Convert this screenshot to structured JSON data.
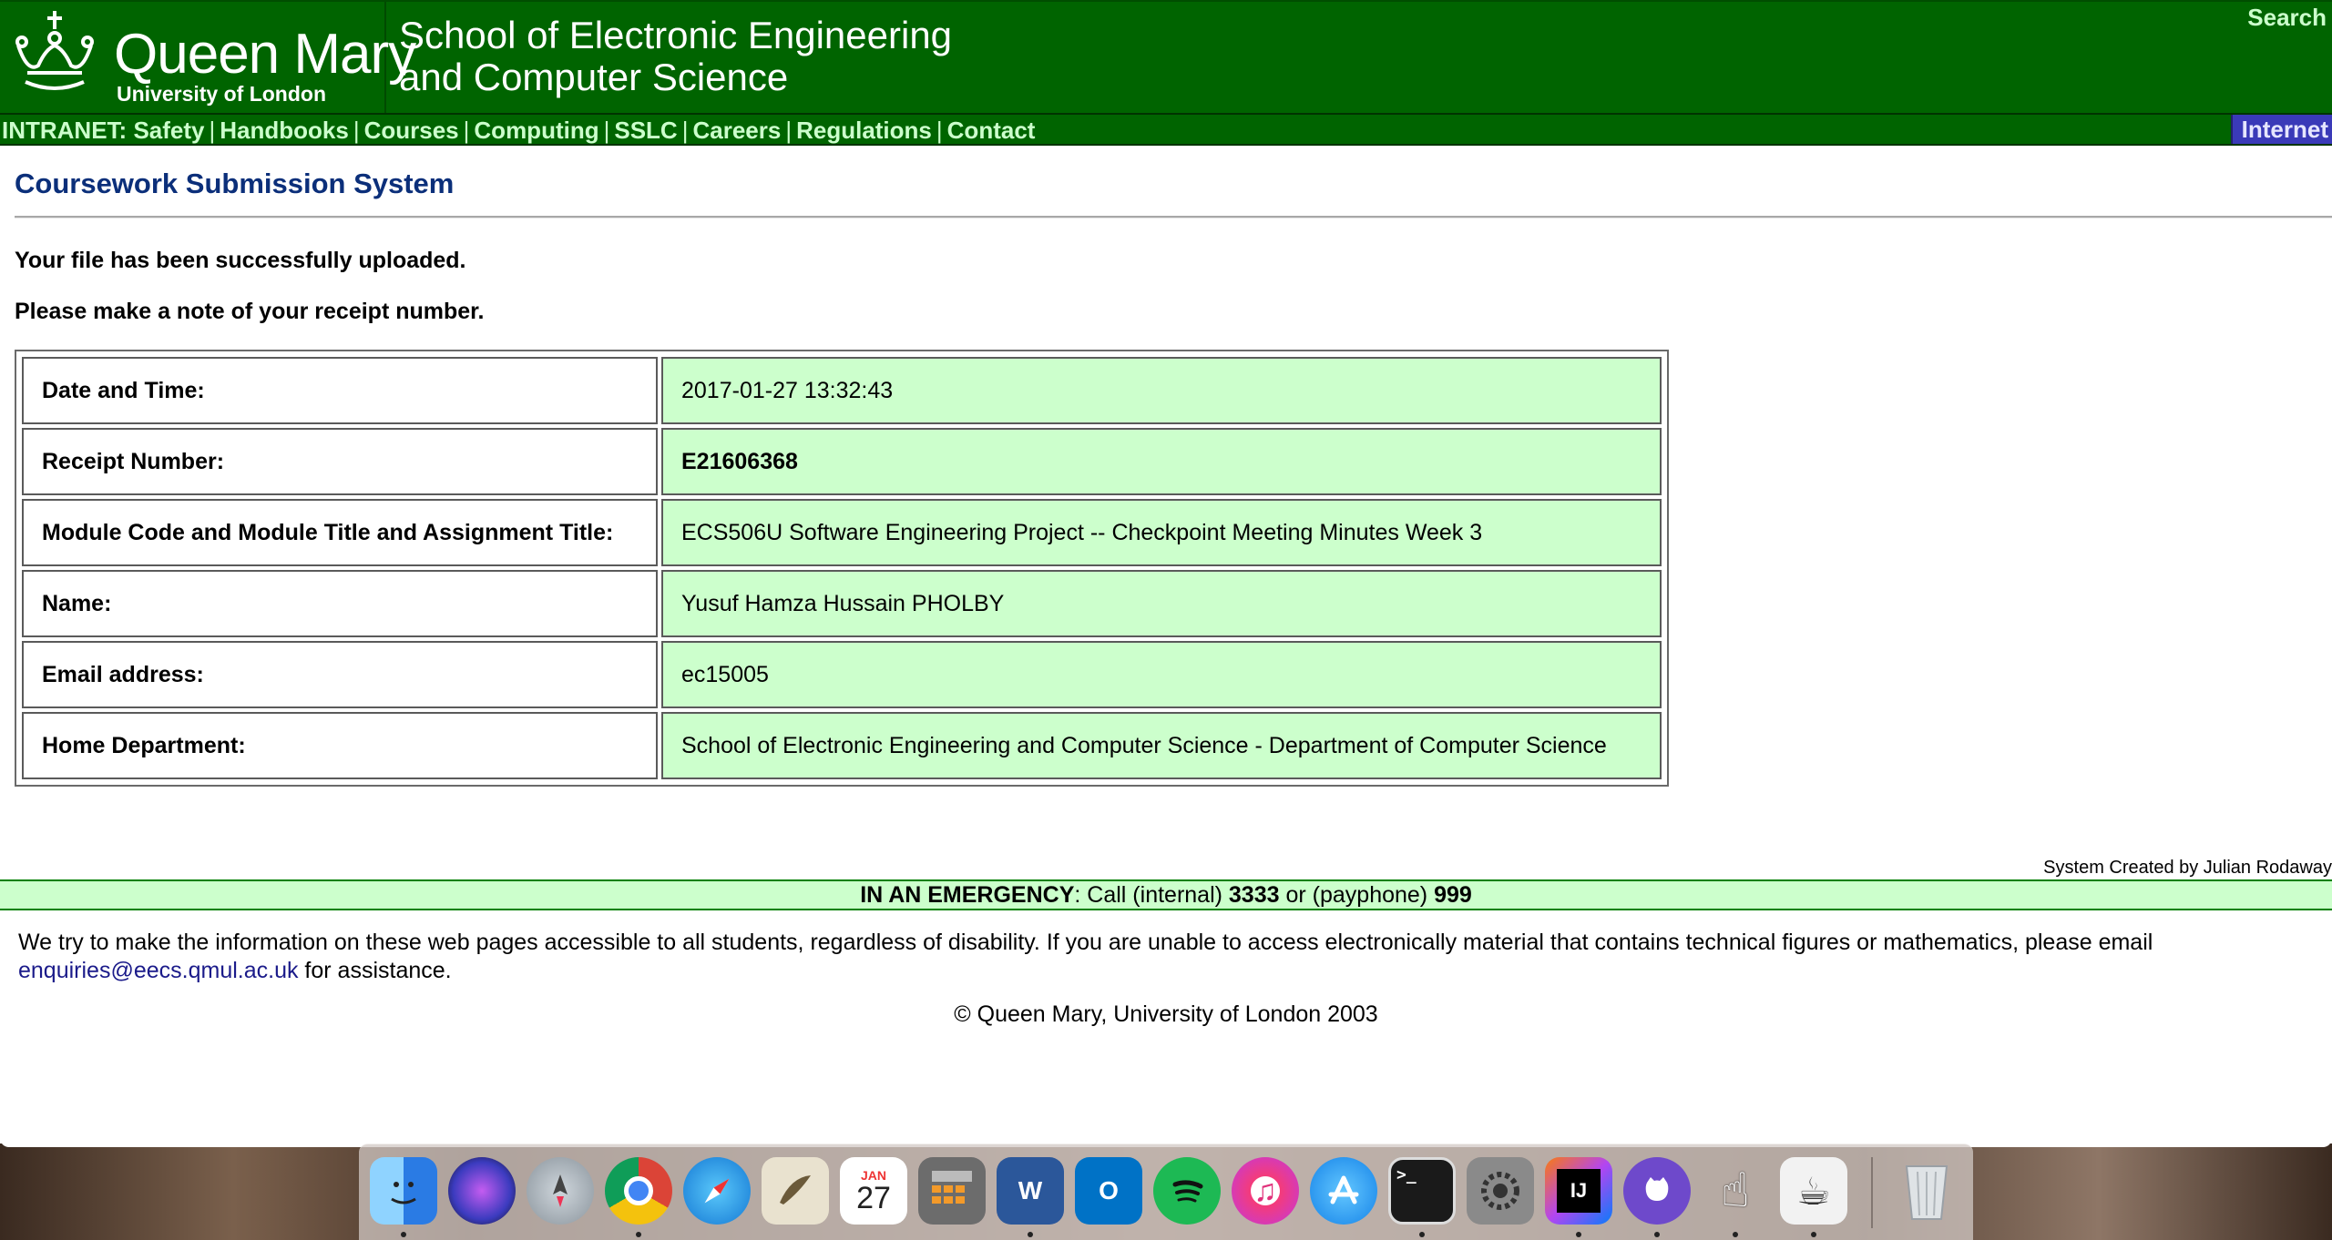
{
  "header": {
    "logo_name": "Queen Mary",
    "logo_sub": "University of London",
    "school_line1": "School of Electronic Engineering",
    "school_line2": "and Computer Science",
    "search": "Search"
  },
  "nav": {
    "prefix": "INTRANET: ",
    "items": [
      "Safety",
      "Handbooks",
      "Courses",
      "Computing",
      "SSLC",
      "Careers",
      "Regulations",
      "Contact"
    ],
    "internet": "Internet"
  },
  "main": {
    "title": "Coursework Submission System",
    "msg_uploaded": "Your file has been successfully uploaded.",
    "msg_note": "Please make a note of your receipt number.",
    "rows": [
      {
        "label": "Date and Time:",
        "value": "2017-01-27 13:32:43"
      },
      {
        "label": "Receipt Number:",
        "value": "E21606368"
      },
      {
        "label": "Module Code and Module Title and Assignment Title:",
        "value": "ECS506U Software Engineering Project -- Checkpoint Meeting Minutes Week 3"
      },
      {
        "label": "Name:",
        "value": "Yusuf Hamza Hussain PHOLBY"
      },
      {
        "label": "Email address:",
        "value": "ec15005"
      },
      {
        "label": "Home Department:",
        "value": "School of Electronic Engineering and Computer Science - Department of Computer Science"
      }
    ]
  },
  "footer": {
    "credits": "System Created by Julian Rodaway",
    "emergency_label": "IN AN EMERGENCY",
    "emergency_call": ": Call (internal) ",
    "internal_number": "3333",
    "emergency_or": " or (payphone) ",
    "payphone_number": "999",
    "access_text": "We try to make the information on these web pages accessible to all students, regardless of disability. If you are unable to access electronically material that contains technical figures or mathematics, please email ",
    "access_email": "enquiries@eecs.qmul.ac.uk",
    "access_tail": " for assistance.",
    "copyright": "© Queen Mary, University of London 2003"
  },
  "dock": {
    "calendar_month": "JAN",
    "calendar_day": "27",
    "word_letter": "W",
    "outlook_letter": "O",
    "intellij_letters": "IJ",
    "terminal_prompt": ">_",
    "apps": [
      "finder-icon",
      "siri-icon",
      "launchpad-icon",
      "chrome-icon",
      "safari-icon",
      "mail-icon",
      "calendar-icon",
      "calculator-icon",
      "word-icon",
      "outlook-icon",
      "spotify-icon",
      "itunes-icon",
      "app-store-icon",
      "terminal-icon",
      "system-preferences-icon",
      "intellij-icon",
      "github-desktop-icon",
      "pointer-app-icon",
      "coffee-app-icon",
      "trash-icon"
    ]
  },
  "colors": {
    "header_green": "#006400",
    "nav_text": "#ccffcc",
    "title_blue": "#0b2f7a",
    "value_bg": "#ccffcc",
    "internet_bg": "#3a3ab8"
  }
}
